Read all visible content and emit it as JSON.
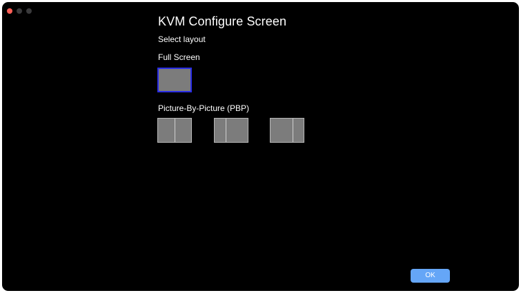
{
  "window": {
    "title": "KVM Configure Screen",
    "subtitle": "Select layout"
  },
  "sections": {
    "full_screen": {
      "label": "Full Screen",
      "selected": true,
      "selection_color": "#2a2de6"
    },
    "pbp": {
      "label": "Picture-By-Picture (PBP)",
      "options": [
        {
          "name": "pbp-even-split"
        },
        {
          "name": "pbp-left-narrow"
        },
        {
          "name": "pbp-right-narrow"
        }
      ]
    }
  },
  "footer": {
    "ok_label": "OK"
  },
  "colors": {
    "background": "#000000",
    "accent": "#65a6f7",
    "tile": "#7c7c7c",
    "close_light": "#ff5f57"
  }
}
